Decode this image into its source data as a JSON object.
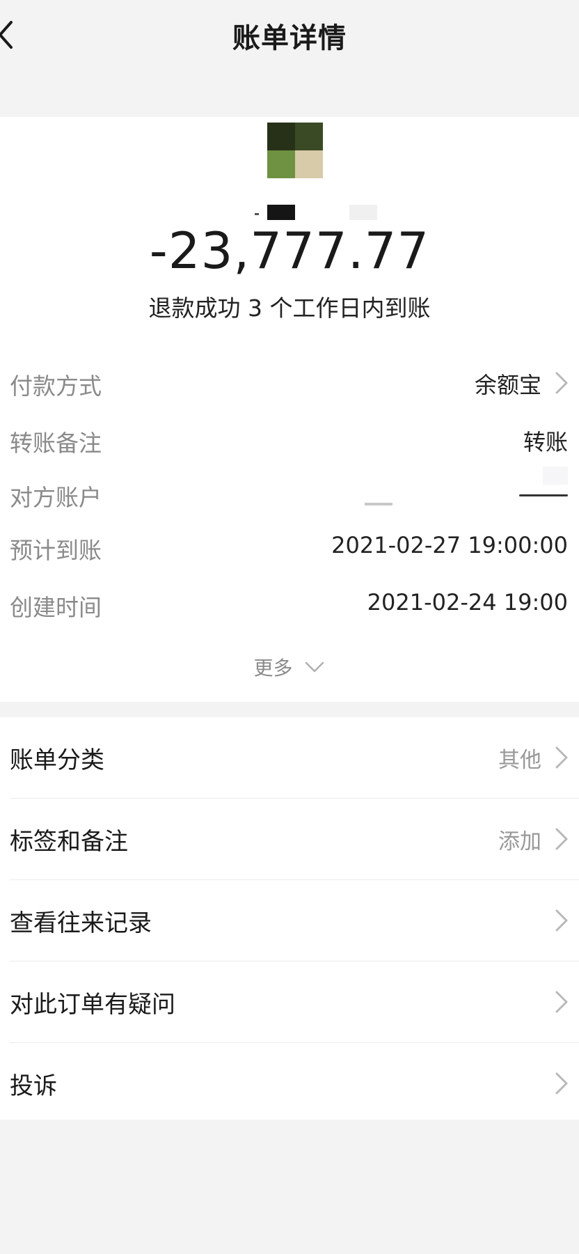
{
  "nav": {
    "title": "账单详情"
  },
  "summary": {
    "amount": "-23,777.77",
    "status": "退款成功 3 个工作日内到账"
  },
  "details": [
    {
      "label": "付款方式",
      "value": "余额宝"
    },
    {
      "label": "转账备注",
      "value": "转账"
    },
    {
      "label": "对方账户",
      "value": ""
    },
    {
      "label": "预计到账",
      "value": "2021-02-27 19:00:00"
    },
    {
      "label": "创建时间",
      "value": "2021-02-24 19:00"
    }
  ],
  "more": {
    "label": "更多"
  },
  "actions": [
    {
      "label": "账单分类",
      "value": "其他"
    },
    {
      "label": "标签和备注",
      "value": "添加"
    },
    {
      "label": "查看往来记录",
      "value": ""
    },
    {
      "label": "对此订单有疑问",
      "value": ""
    },
    {
      "label": "投诉",
      "value": ""
    }
  ],
  "icons": {
    "back": "chevron-left-icon",
    "row_arrow": "chevron-right-icon",
    "more": "chevron-down-icon"
  },
  "colors": {
    "page_background": "#f3f3f4",
    "card_background": "#ffffff",
    "label_gray": "#8a8a8a",
    "text_dark": "#1a1a1a"
  }
}
